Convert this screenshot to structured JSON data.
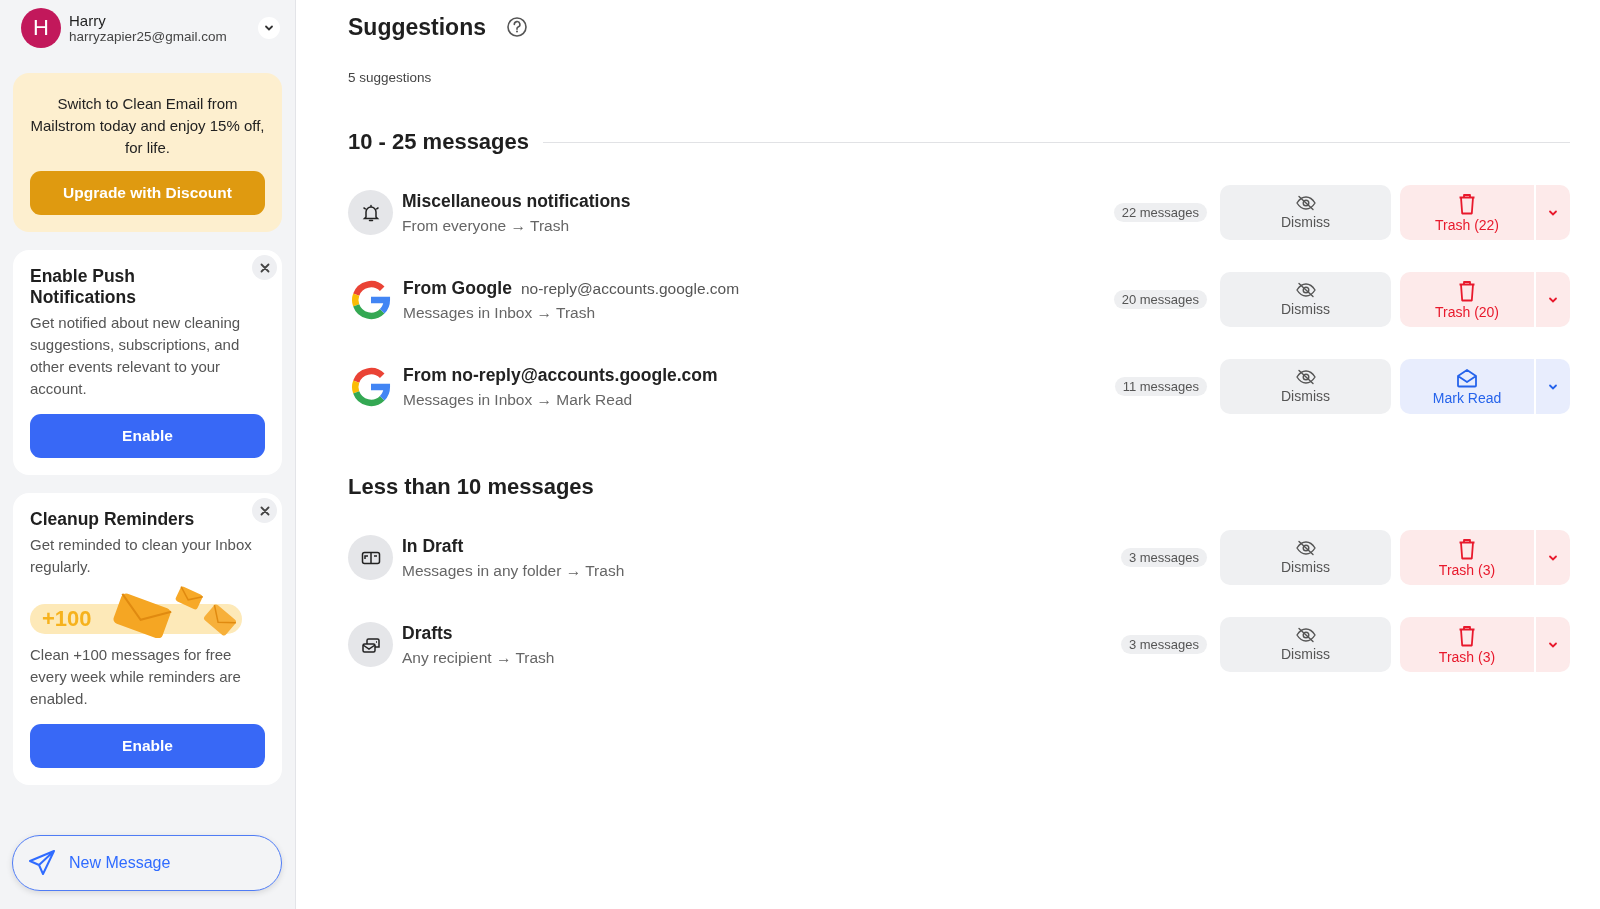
{
  "account": {
    "initial": "H",
    "name": "Harry",
    "email": "harryzapier25@gmail.com"
  },
  "promo": {
    "text": "Switch to Clean Email from Mailstrom today and enjoy 15% off, for life.",
    "button": "Upgrade with Discount"
  },
  "cards": [
    {
      "kind": "push",
      "title": "Enable Push Notifications",
      "text": "Get notified about new cleaning suggestions, subscriptions, and other events relevant to your account.",
      "button": "Enable"
    },
    {
      "kind": "reminders",
      "title": "Cleanup Reminders",
      "text": "Get reminded to clean your Inbox regularly.",
      "reward": "+100",
      "note": "Clean +100 messages for free every week while reminders are enabled.",
      "button": "Enable"
    }
  ],
  "new_message": "New Message",
  "page": {
    "title": "Suggestions",
    "count": "5 suggestions"
  },
  "groups": [
    {
      "heading": "10 - 25 messages",
      "divider": true,
      "rows": [
        {
          "kind": "bell",
          "title": "Miscellaneous notifications",
          "detail": "From everyone → Trash",
          "count": "22 messages",
          "dismiss": "Dismiss",
          "action": {
            "kind": "trash",
            "label": "Trash (22)"
          }
        },
        {
          "kind": "google",
          "title": "From Google",
          "sender": "no-reply@accounts.google.com",
          "detail": "Messages in Inbox → Trash",
          "count": "20 messages",
          "dismiss": "Dismiss",
          "action": {
            "kind": "trash",
            "label": "Trash (20)"
          }
        },
        {
          "kind": "google",
          "title": "From no-reply@accounts.google.com",
          "detail": "Messages in Inbox → Mark Read",
          "count": "11 messages",
          "dismiss": "Dismiss",
          "action": {
            "kind": "read",
            "label": "Mark Read"
          }
        }
      ]
    },
    {
      "heading": "Less than 10 messages",
      "divider": false,
      "rows": [
        {
          "kind": "inbox",
          "title": "In Draft",
          "detail": "Messages in any folder → Trash",
          "count": "3 messages",
          "dismiss": "Dismiss",
          "action": {
            "kind": "trash",
            "label": "Trash (3)"
          }
        },
        {
          "kind": "drafts",
          "title": "Drafts",
          "detail": "Any recipient → Trash",
          "count": "3 messages",
          "dismiss": "Dismiss",
          "action": {
            "kind": "trash",
            "label": "Trash (3)"
          }
        }
      ]
    }
  ]
}
